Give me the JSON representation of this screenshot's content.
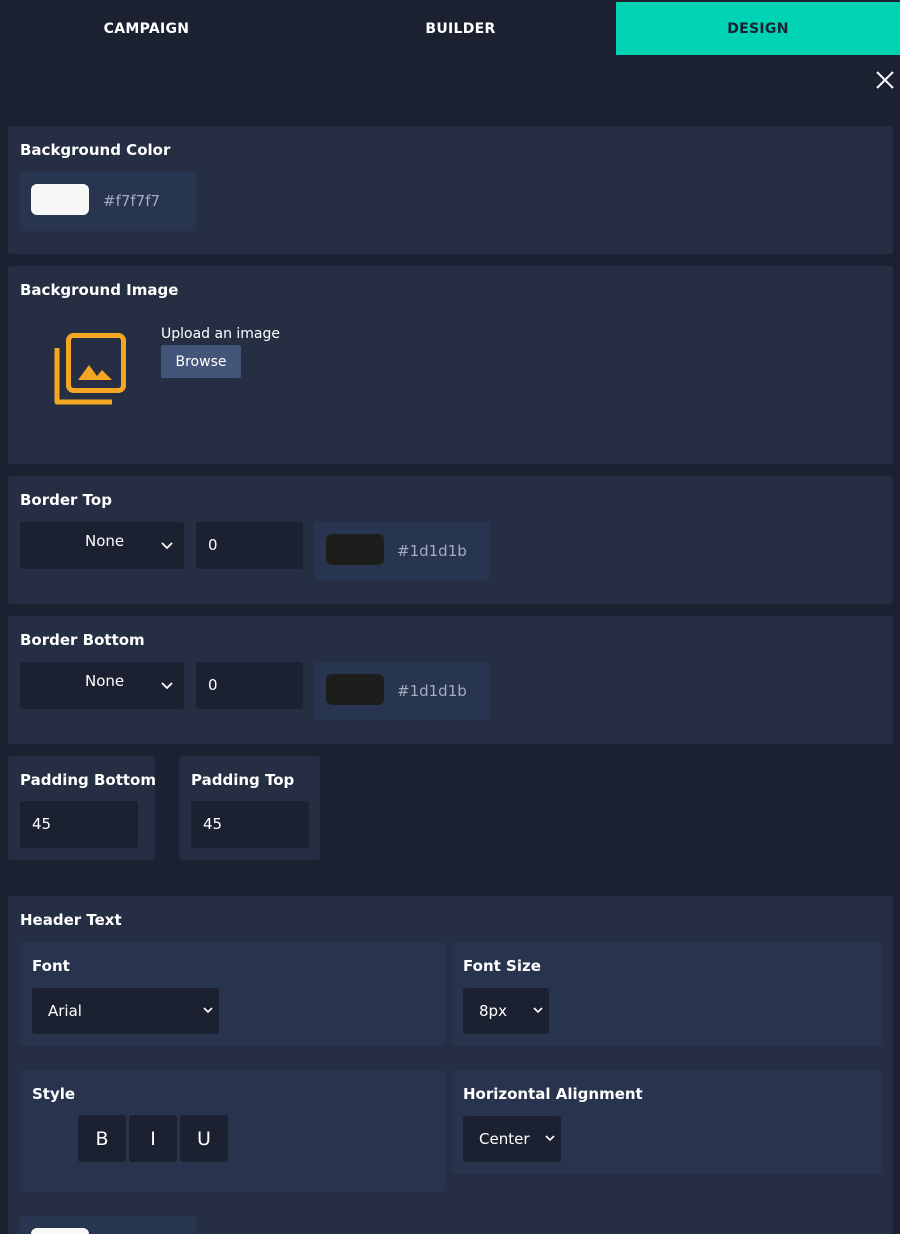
{
  "tabs": [
    {
      "label": "CAMPAIGN"
    },
    {
      "label": "BUILDER"
    },
    {
      "label": "DESIGN",
      "active": true
    }
  ],
  "close_icon": "close-icon",
  "background_color": {
    "label": "Background Color",
    "value": "#f7f7f7",
    "swatch_color": "#f7f7f7"
  },
  "background_image": {
    "label": "Background Image",
    "upload_text": "Upload an image",
    "browse_label": "Browse",
    "icon": "image-gallery-icon",
    "icon_color": "#f5a623"
  },
  "border_top": {
    "label": "Border Top",
    "style": "None",
    "width": "0",
    "color_value": "#1d1d1b",
    "swatch_color": "#1d1d1b"
  },
  "border_bottom": {
    "label": "Border Bottom",
    "style": "None",
    "width": "0",
    "color_value": "#1d1d1b",
    "swatch_color": "#1d1d1b"
  },
  "padding_bottom": {
    "label": "Padding Bottom",
    "value": "45"
  },
  "padding_top": {
    "label": "Padding Top",
    "value": "45"
  },
  "header_text": {
    "label": "Header Text",
    "font": {
      "label": "Font",
      "value": "Arial"
    },
    "font_size": {
      "label": "Font Size",
      "value": "8px"
    },
    "style": {
      "label": "Style",
      "bold": "B",
      "italic": "I",
      "underline": "U"
    },
    "alignment": {
      "label": "Horizontal Alignment",
      "value": "Center"
    }
  },
  "colors": {
    "accent": "#00d3b4",
    "panel": "#252e42",
    "background": "#1b2130",
    "browse_button": "#43567a"
  }
}
